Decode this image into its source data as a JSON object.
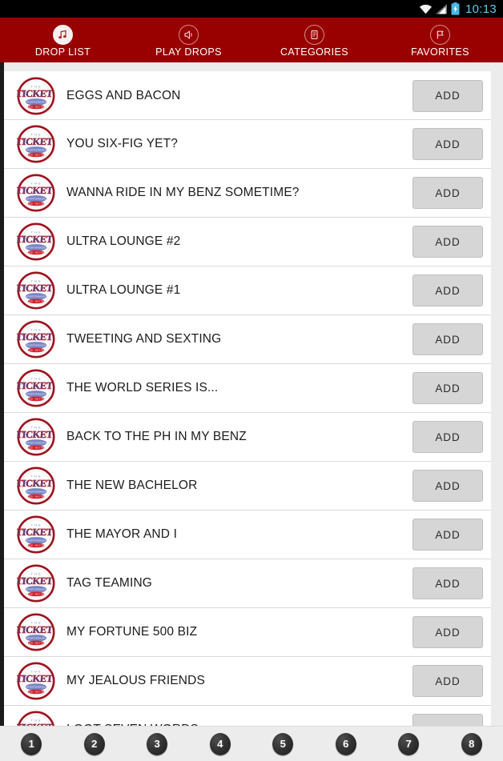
{
  "statusbar": {
    "time": "10:13",
    "wifi_icon": "wifi-icon",
    "signal_icon": "cellular-signal-icon",
    "battery_icon": "battery-charging-icon"
  },
  "tabs": [
    {
      "label": "DROP LIST",
      "icon": "music-note-icon",
      "active": true
    },
    {
      "label": "PLAY DROPS",
      "icon": "speaker-icon",
      "active": false
    },
    {
      "label": "CATEGORIES",
      "icon": "book-icon",
      "active": false
    },
    {
      "label": "FAVORITES",
      "icon": "flag-icon",
      "active": false
    }
  ],
  "list": {
    "add_label": "ADD",
    "thumb_icon": "the-ticket-logo",
    "items": [
      {
        "title": "EGGS AND BACON"
      },
      {
        "title": "YOU SIX-FIG YET?"
      },
      {
        "title": "WANNA RIDE IN MY BENZ SOMETIME?"
      },
      {
        "title": "ULTRA LOUNGE #2"
      },
      {
        "title": "ULTRA LOUNGE #1"
      },
      {
        "title": "TWEETING AND SEXTING"
      },
      {
        "title": "THE WORLD SERIES IS..."
      },
      {
        "title": "BACK TO THE PH IN MY BENZ"
      },
      {
        "title": "THE NEW BACHELOR"
      },
      {
        "title": "THE MAYOR AND I"
      },
      {
        "title": "TAG TEAMING"
      },
      {
        "title": "MY FORTUNE 500 BIZ"
      },
      {
        "title": "MY JEALOUS FRIENDS"
      },
      {
        "title": "I GOT SEVEN WORDS"
      }
    ]
  },
  "pager": {
    "pages": [
      "1",
      "2",
      "3",
      "4",
      "5",
      "6",
      "7",
      "8"
    ]
  },
  "colors": {
    "header_red": "#990000",
    "status_black": "#000000",
    "time_blue": "#5ec8e5",
    "page_bg": "#ececec",
    "row_bg": "#ffffff",
    "add_btn_bg": "#d6d6d6"
  }
}
